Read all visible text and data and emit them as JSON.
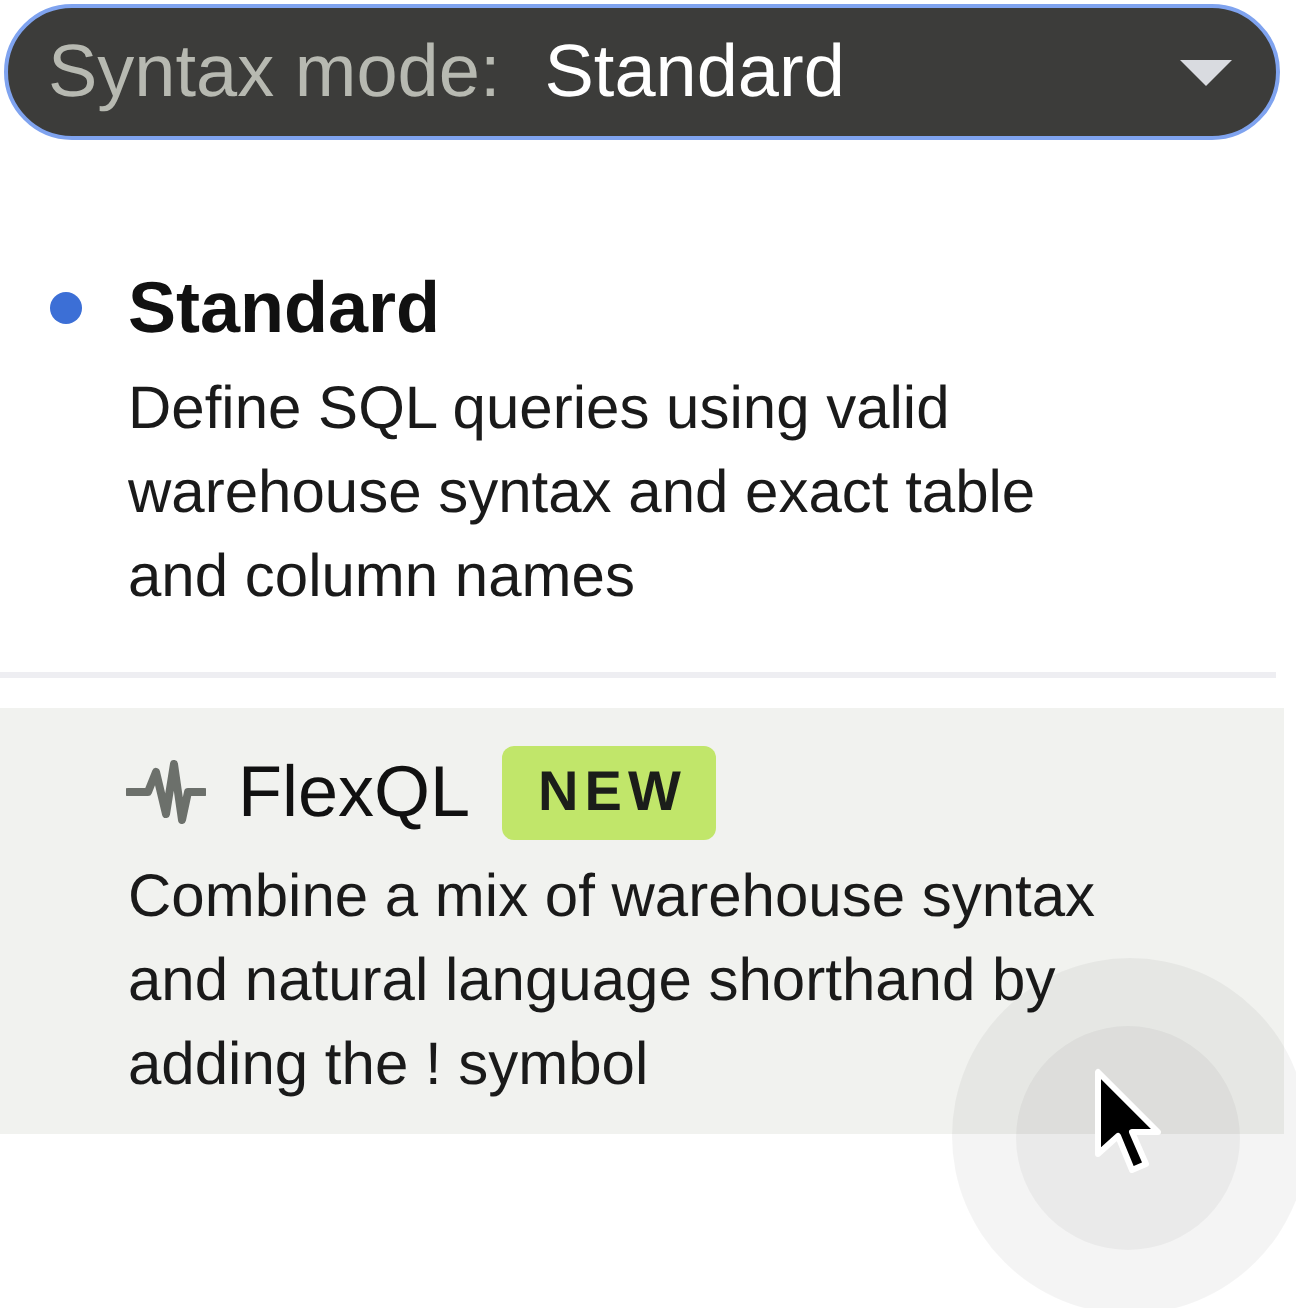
{
  "dropdown": {
    "label": "Syntax mode:",
    "value": "Standard",
    "expanded": true
  },
  "options": [
    {
      "kind": "plain",
      "title": "Standard",
      "description": "Define SQL queries using valid warehouse syntax and exact table and column names",
      "selected": true,
      "hovered": false
    },
    {
      "kind": "flex",
      "title": "FlexQL",
      "badge": "NEW",
      "description": "Combine a mix of warehouse syntax and natural language shorthand by adding the ! symbol",
      "selected": false,
      "hovered": true
    }
  ]
}
